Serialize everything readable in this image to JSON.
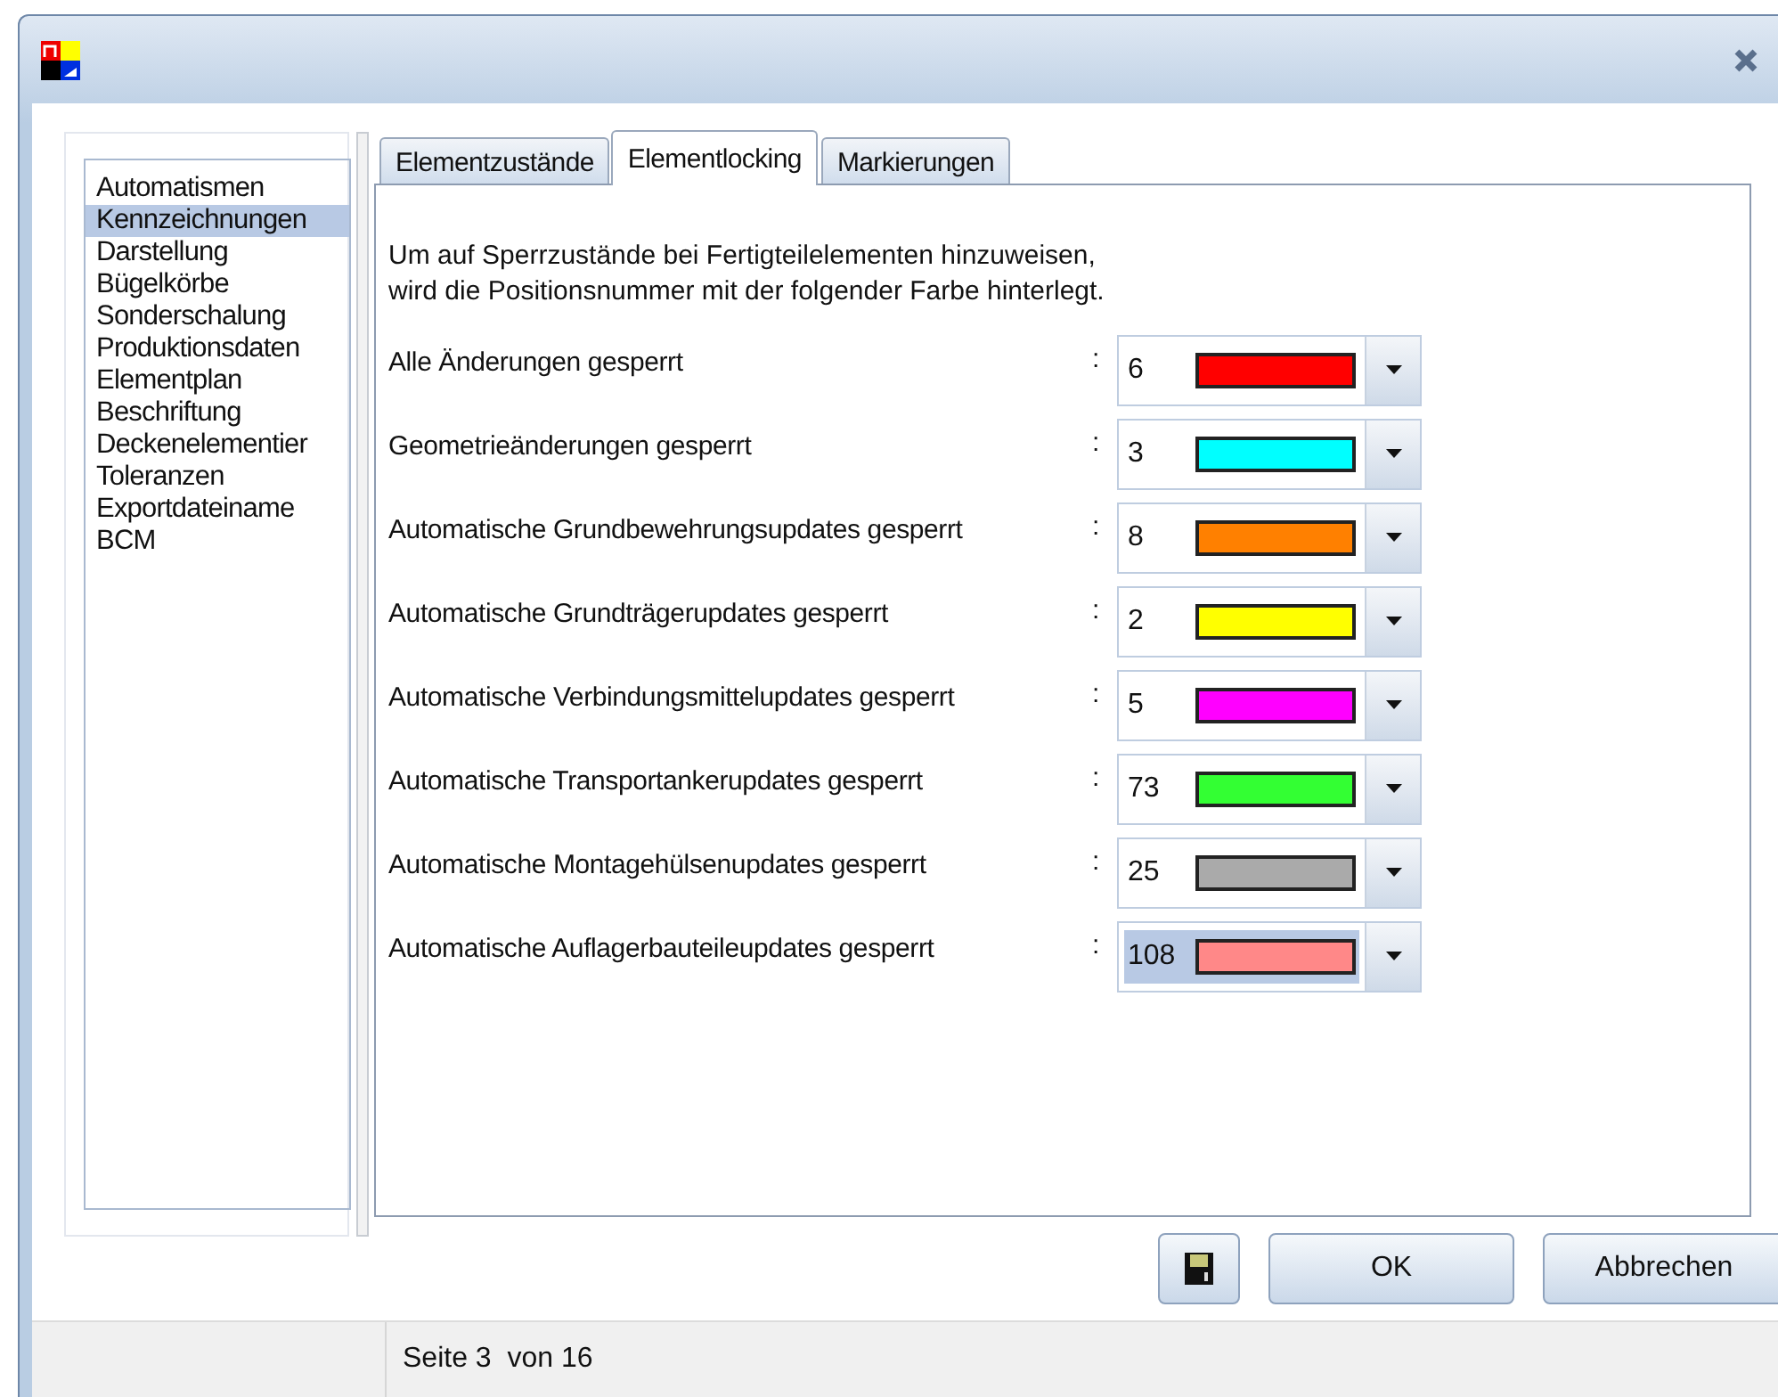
{
  "sidebar": {
    "items": [
      {
        "label": "Automatismen",
        "selected": false
      },
      {
        "label": "Kennzeichnungen",
        "selected": true
      },
      {
        "label": "Darstellung",
        "selected": false
      },
      {
        "label": "Bügelkörbe",
        "selected": false
      },
      {
        "label": "Sonderschalung",
        "selected": false
      },
      {
        "label": "Produktionsdaten",
        "selected": false
      },
      {
        "label": "Elementplan",
        "selected": false
      },
      {
        "label": "Beschriftung",
        "selected": false
      },
      {
        "label": "Deckenelementier",
        "selected": false
      },
      {
        "label": "Toleranzen",
        "selected": false
      },
      {
        "label": "Exportdateiname",
        "selected": false
      },
      {
        "label": "BCM",
        "selected": false
      }
    ]
  },
  "tabs": [
    {
      "label": "Elementzustände",
      "selected": false
    },
    {
      "label": "Elementlocking",
      "selected": true
    },
    {
      "label": "Markierungen",
      "selected": false
    }
  ],
  "intro": [
    "Um auf Sperrzustände bei Fertigteilelementen hinzuweisen,",
    "wird die Positionsnummer mit der folgender Farbe hinterlegt."
  ],
  "rows": [
    {
      "label": "Alle Änderungen gesperrt",
      "separator": ":",
      "value": "6",
      "color": "#ff0000",
      "selected": false
    },
    {
      "label": "Geometrieänderungen gesperrt",
      "separator": ":",
      "value": "3",
      "color": "#00ffff",
      "selected": false
    },
    {
      "label": "Automatische Grundbewehrungsupdates gesperrt",
      "separator": ":",
      "value": "8",
      "color": "#ff8000",
      "selected": false
    },
    {
      "label": "Automatische Grundträgerupdates gesperrt",
      "separator": ":",
      "value": "2",
      "color": "#ffff00",
      "selected": false
    },
    {
      "label": "Automatische Verbindungsmittelupdates gesperrt",
      "separator": ":",
      "value": "5",
      "color": "#ff00ff",
      "selected": false
    },
    {
      "label": "Automatische Transportankerupdates gesperrt",
      "separator": ":",
      "value": "73",
      "color": "#33ff33",
      "selected": false
    },
    {
      "label": "Automatische Montagehülsenupdates gesperrt",
      "separator": ":",
      "value": "25",
      "color": "#aaaaaa",
      "selected": false
    },
    {
      "label": "Automatische Auflagerbauteileupdates gesperrt",
      "separator": ":",
      "value": "108",
      "color": "#ff8888",
      "selected": true
    }
  ],
  "buttons": [
    {
      "kind": "save"
    },
    {
      "kind": "text",
      "label": "OK"
    },
    {
      "kind": "text",
      "label": "Abbrechen"
    }
  ],
  "status_bar": {
    "page": "Seite 3  von 16"
  }
}
